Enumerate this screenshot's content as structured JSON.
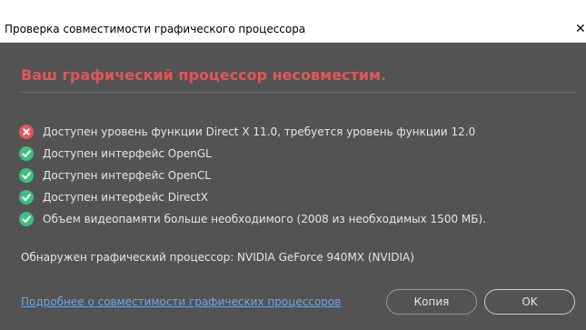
{
  "window": {
    "title": "Проверка совместимости графического процессора",
    "close_glyph": "✕"
  },
  "main": {
    "heading": "Ваш графический процессор несовместим.",
    "checks": [
      {
        "status": "fail",
        "icon": "error-circle-icon",
        "label": "Доступен уровень функции Direct X 11.0, требуется уровень функции 12.0"
      },
      {
        "status": "pass",
        "icon": "check-circle-icon",
        "label": "Доступен интерфейс OpenGL"
      },
      {
        "status": "pass",
        "icon": "check-circle-icon",
        "label": "Доступен интерфейс OpenCL"
      },
      {
        "status": "pass",
        "icon": "check-circle-icon",
        "label": "Доступен интерфейс DirectX"
      },
      {
        "status": "pass",
        "icon": "check-circle-icon",
        "label": "Объем видеопамяти больше необходимого (2008 из необходимых 1500 МБ)."
      }
    ],
    "detected": "Обнаружен графический процессор: NVIDIA GeForce 940MX (NVIDIA)"
  },
  "footer": {
    "link": "Подробнее о совместимости графических процессоров",
    "copy_label": "Копия",
    "ok_label": "OK"
  },
  "colors": {
    "background": "#535353",
    "heading": "#e25656",
    "pass": "#3fbf7f",
    "fail": "#e05a5a",
    "link": "#6fa8e8"
  }
}
